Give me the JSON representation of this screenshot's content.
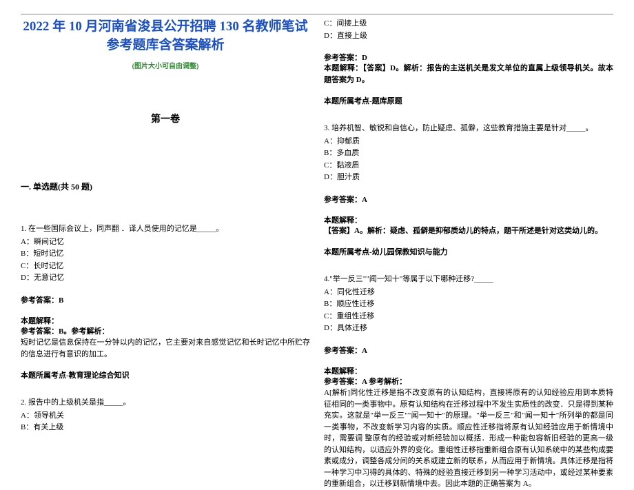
{
  "title": "2022 年 10 月河南省浚县公开招聘 130 名教师笔试参考题库含答案解析",
  "subtitle": "(图片大小可自由调整)",
  "scroll": "第一卷",
  "section": "一. 单选题(共 50 题)",
  "q1": {
    "stem": "1. 在一些国际会议上，同声翻 ．译人员使用的记忆是_____。",
    "a": "A：瞬间记忆",
    "b": "B：短时记忆",
    "c": "C：长时记忆",
    "d": "D：无意记忆",
    "ans_label": "参考答案：B",
    "exp_label": "本题解释：",
    "exp_line1": "参考答案：B。参考解析：",
    "exp_body": "短时记忆是信息保持在一分钟以内的记忆，它主要对来自感觉记忆和长时记忆中所贮存的信息进行有意识的加工。",
    "point": "本题所属考点-教育理论综合知识"
  },
  "q2": {
    "stem": "2. 报告中的上级机关是指_____。",
    "a": "A：领导机关",
    "b": "B：有关上级",
    "c": "C：间接上级",
    "d": "D：直接上级",
    "ans_label": "参考答案：D",
    "exp_body": "本题解释：【答案】D。解析：报告的主送机关是发文单位的直属上级领导机关。故本题答案为 D。",
    "point": "本题所属考点-题库原题"
  },
  "q3": {
    "stem": "3. 培养机智、敏锐和自信心，防止疑虑、孤僻，这些教育措施主要是针对_____。",
    "a": "A：抑郁质",
    "b": "B：多血质",
    "c": "C：黏液质",
    "d": "D：胆汁质",
    "ans_label": "参考答案：A",
    "exp_label": "本题解释：",
    "exp_body": "【答案】A。解析：疑虑、孤僻是抑郁质幼儿的特点，题干所述是针对这类幼儿的。",
    "point": "本题所属考点-幼儿园保教知识与能力"
  },
  "q4": {
    "stem": "4.\"举一反三\"\"闻一知十\"等属于以下哪种迁移?_____",
    "a": "A：同化性迁移",
    "b": "B：顺应性迁移",
    "c": "C：重组性迁移",
    "d": "D：具体迁移",
    "ans_label": "参考答案：A",
    "exp_label": "本题解释：",
    "exp_line1": "参考答案：A 参考解析：",
    "exp_body": "A[解析]同化性迁移是指不改变原有的认知结构，直接将原有的认知经验应用到本质特征相同的一类事物中。原有认知结构在迁移过程中不发生实质性的改变．只是得到某种充实。这就是\"举一反三\"\"闻一知十\"的原理。\"举一反三\"和\"闻一知十\"所列举的都是同一类事物，不改变新学习内容的实质。顺应性迁移指将原有认知经验应用于新情境中时，需要调 整原有的经验或对新经验加以概括．形成一种能包容新旧经验的更高一级的认知结构，以适应外界的变化。重组性迁移指重新组合原有认知系统中的某些构成要素或成分，调整各成分间的关系或建立新的联系，从而应用于新情境。具体迁移是指将一种学习中习得的具体的、特殊的经验直接迁移到另一种学习活动中，或经过某种要素的重新组合，以迁移到新情境中去。因此本题的正确答案为 A。"
  }
}
